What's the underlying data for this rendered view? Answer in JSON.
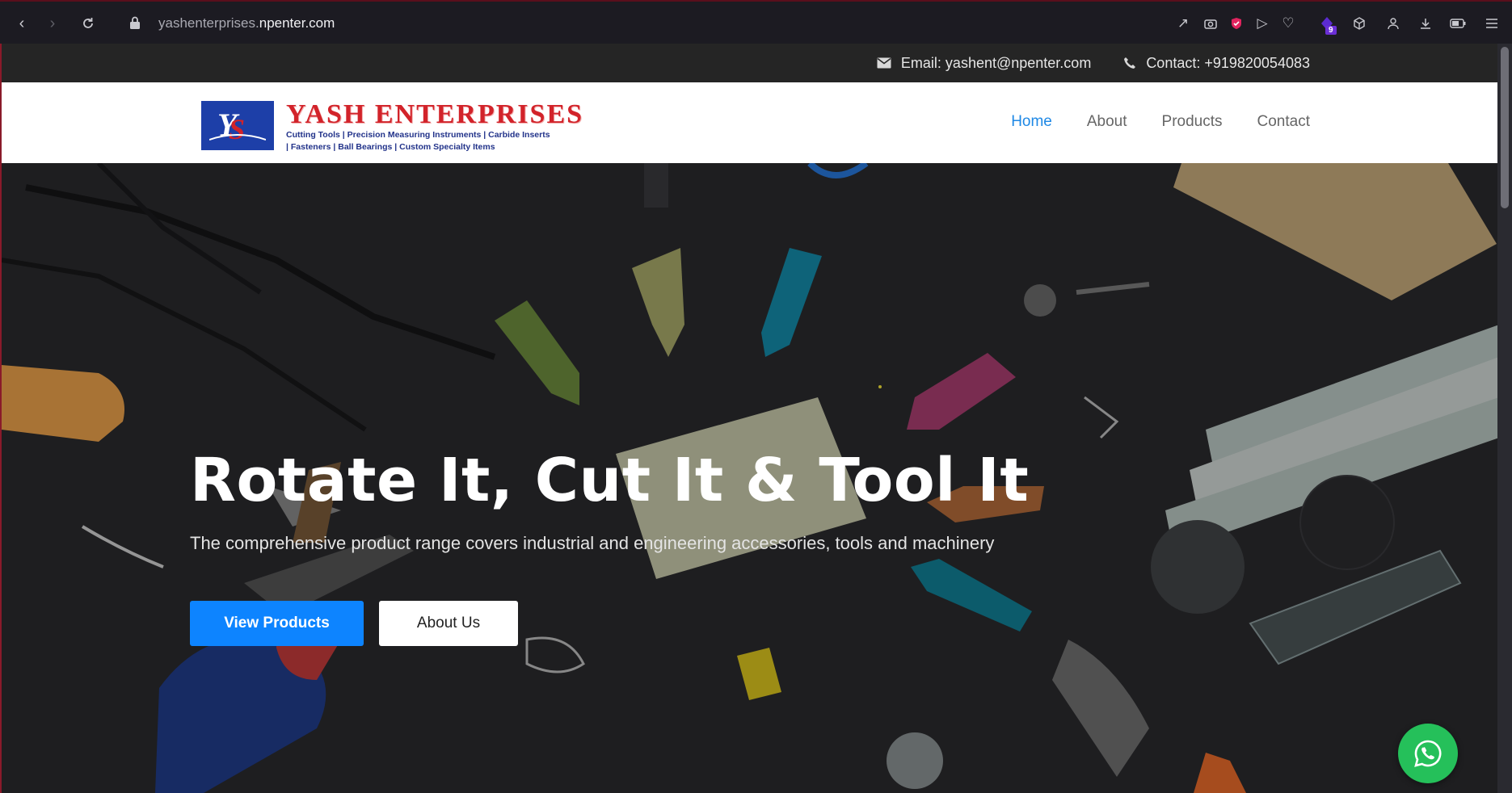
{
  "browser": {
    "url_prefix": "yashenterprises.",
    "url_domain": "npenter.com",
    "extension_badge": "9"
  },
  "topbar": {
    "email": "Email: yashent@npenter.com",
    "contact": "Contact: +919820054083"
  },
  "header": {
    "brand_name": "YASH ENTERPRISES",
    "tagline_line1": "Cutting Tools | Precision Measuring Instruments | Carbide Inserts",
    "tagline_line2": "| Fasteners | Ball Bearings | Custom Specialty Items",
    "nav": [
      {
        "label": "Home",
        "active": true
      },
      {
        "label": "About",
        "active": false
      },
      {
        "label": "Products",
        "active": false
      },
      {
        "label": "Contact",
        "active": false
      }
    ]
  },
  "hero": {
    "title": "Rotate It, Cut It & Tool It",
    "subtitle": "The comprehensive product range covers industrial and engineering accessories, tools and machinery",
    "primary_button": "View Products",
    "secondary_button": "About Us"
  },
  "colors": {
    "accent": "#1e88e5",
    "button_primary": "#0d84ff",
    "brand_red": "#d2232a",
    "whatsapp_green": "#25c05a"
  }
}
